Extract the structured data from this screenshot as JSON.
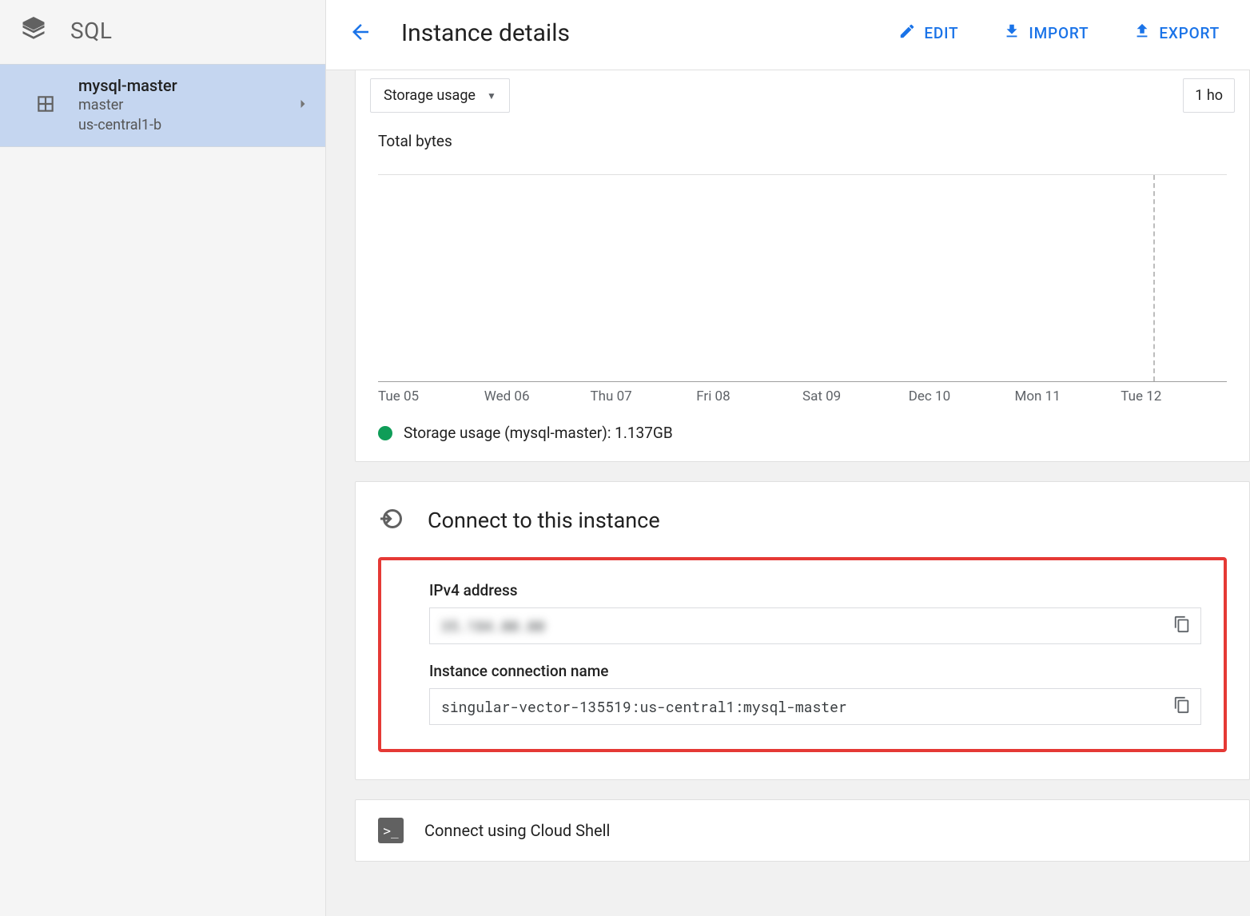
{
  "sidebar": {
    "product_label": "SQL",
    "instance": {
      "name": "mysql-master",
      "role": "master",
      "zone": "us-central1-b"
    }
  },
  "header": {
    "title": "Instance details",
    "actions": {
      "edit": "EDIT",
      "import": "IMPORT",
      "export": "EXPORT"
    }
  },
  "chart": {
    "metric_dropdown": "Storage usage",
    "time_dropdown": "1 ho",
    "y_label": "Total bytes",
    "legend": "Storage usage (mysql-master): 1.137GB"
  },
  "chart_data": {
    "type": "line",
    "title": "Storage usage",
    "ylabel": "Total bytes",
    "x_ticks": [
      "Tue 05",
      "Wed 06",
      "Thu 07",
      "Fri 08",
      "Sat 09",
      "Dec 10",
      "Mon 11",
      "Tue 12"
    ],
    "series": [
      {
        "name": "Storage usage (mysql-master)",
        "latest_value_gb": 1.137,
        "values": []
      }
    ],
    "note": "No visible data line rendered in screenshot; only axis ticks and a vertical cursor near Mon 11–Tue 12."
  },
  "connect": {
    "section_title": "Connect to this instance",
    "ipv4_label": "IPv4 address",
    "ipv4_value": "35.184.00.00",
    "conn_name_label": "Instance connection name",
    "conn_name_value": "singular-vector-135519:us-central1:mysql-master",
    "cloud_shell_label": "Connect using Cloud Shell"
  }
}
